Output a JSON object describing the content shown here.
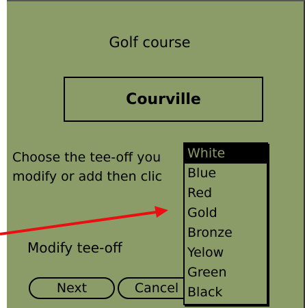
{
  "window": {
    "title": "Golf course"
  },
  "course": {
    "name": "Courville"
  },
  "instruction": {
    "line1": "Choose the tee-off you",
    "line2": "modify or add then clic"
  },
  "modify": {
    "label": "Modify tee-off"
  },
  "buttons": {
    "next": "Next",
    "cancel": "Cancel"
  },
  "dropdown": {
    "selected": "White",
    "options": [
      "White",
      "Blue",
      "Red",
      "Gold",
      "Bronze",
      "Yelow",
      "Green",
      "Black"
    ]
  },
  "colors": {
    "screen": "#8c9c68",
    "arrow": "#e81010"
  }
}
